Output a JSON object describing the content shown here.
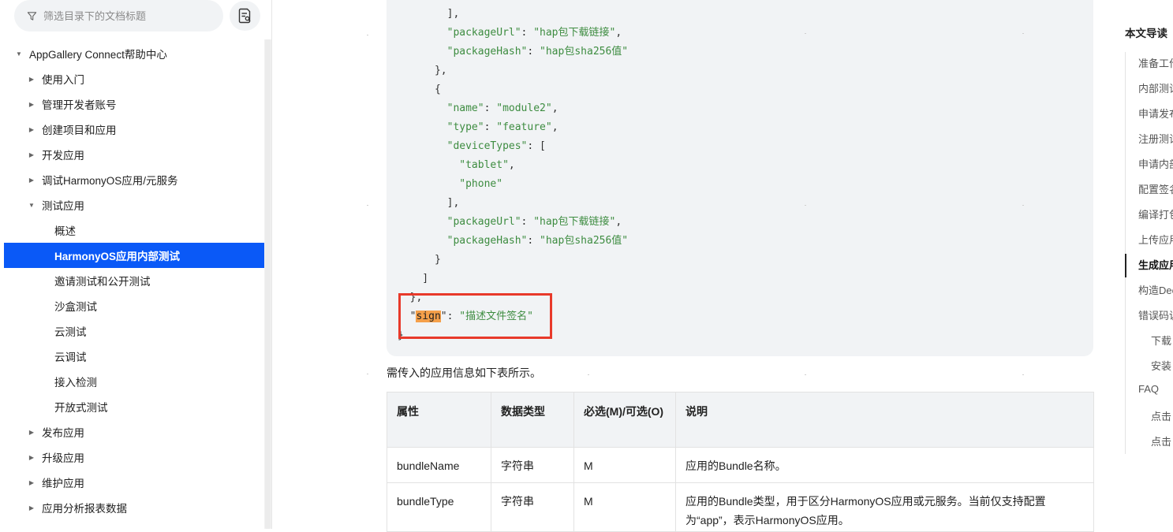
{
  "sidebar": {
    "filter_placeholder": "筛选目录下的文档标题",
    "items": [
      {
        "label": "AppGallery Connect帮助中心",
        "level": 0,
        "state": "expanded"
      },
      {
        "label": "使用入门",
        "level": 1,
        "state": "collapsed"
      },
      {
        "label": "管理开发者账号",
        "level": 1,
        "state": "collapsed"
      },
      {
        "label": "创建项目和应用",
        "level": 1,
        "state": "collapsed"
      },
      {
        "label": "开发应用",
        "level": 1,
        "state": "collapsed"
      },
      {
        "label": "调试HarmonyOS应用/元服务",
        "level": 1,
        "state": "collapsed"
      },
      {
        "label": "测试应用",
        "level": 1,
        "state": "expanded"
      },
      {
        "label": "概述",
        "level": 2,
        "state": "leaf"
      },
      {
        "label": "HarmonyOS应用内部测试",
        "level": 2,
        "state": "leaf",
        "active": true
      },
      {
        "label": "邀请测试和公开测试",
        "level": 2,
        "state": "leaf"
      },
      {
        "label": "沙盒测试",
        "level": 2,
        "state": "leaf"
      },
      {
        "label": "云测试",
        "level": 2,
        "state": "leaf"
      },
      {
        "label": "云调试",
        "level": 2,
        "state": "leaf"
      },
      {
        "label": "接入检测",
        "level": 2,
        "state": "leaf"
      },
      {
        "label": "开放式测试",
        "level": 2,
        "state": "leaf"
      },
      {
        "label": "发布应用",
        "level": 1,
        "state": "collapsed"
      },
      {
        "label": "升级应用",
        "level": 1,
        "state": "collapsed"
      },
      {
        "label": "维护应用",
        "level": 1,
        "state": "collapsed"
      },
      {
        "label": "应用分析报表数据",
        "level": 1,
        "state": "collapsed"
      }
    ]
  },
  "code": {
    "lines": [
      [
        {
          "t": "p",
          "v": "        ],"
        }
      ],
      [
        {
          "t": "p",
          "v": "        "
        },
        {
          "t": "k",
          "v": "\"packageUrl\""
        },
        {
          "t": "p",
          "v": ": "
        },
        {
          "t": "s",
          "v": "\"hap包下载链接\""
        },
        {
          "t": "p",
          "v": ","
        }
      ],
      [
        {
          "t": "p",
          "v": "        "
        },
        {
          "t": "k",
          "v": "\"packageHash\""
        },
        {
          "t": "p",
          "v": ": "
        },
        {
          "t": "s",
          "v": "\"hap包sha256值\""
        }
      ],
      [
        {
          "t": "p",
          "v": "      },"
        }
      ],
      [
        {
          "t": "p",
          "v": "      {"
        }
      ],
      [
        {
          "t": "p",
          "v": "        "
        },
        {
          "t": "k",
          "v": "\"name\""
        },
        {
          "t": "p",
          "v": ": "
        },
        {
          "t": "s",
          "v": "\"module2\""
        },
        {
          "t": "p",
          "v": ","
        }
      ],
      [
        {
          "t": "p",
          "v": "        "
        },
        {
          "t": "k",
          "v": "\"type\""
        },
        {
          "t": "p",
          "v": ": "
        },
        {
          "t": "s",
          "v": "\"feature\""
        },
        {
          "t": "p",
          "v": ","
        }
      ],
      [
        {
          "t": "p",
          "v": "        "
        },
        {
          "t": "k",
          "v": "\"deviceTypes\""
        },
        {
          "t": "p",
          "v": ": ["
        }
      ],
      [
        {
          "t": "p",
          "v": "          "
        },
        {
          "t": "s",
          "v": "\"tablet\""
        },
        {
          "t": "p",
          "v": ","
        }
      ],
      [
        {
          "t": "p",
          "v": "          "
        },
        {
          "t": "s",
          "v": "\"phone\""
        }
      ],
      [
        {
          "t": "p",
          "v": "        ],"
        }
      ],
      [
        {
          "t": "p",
          "v": "        "
        },
        {
          "t": "k",
          "v": "\"packageUrl\""
        },
        {
          "t": "p",
          "v": ": "
        },
        {
          "t": "s",
          "v": "\"hap包下载链接\""
        },
        {
          "t": "p",
          "v": ","
        }
      ],
      [
        {
          "t": "p",
          "v": "        "
        },
        {
          "t": "k",
          "v": "\"packageHash\""
        },
        {
          "t": "p",
          "v": ": "
        },
        {
          "t": "s",
          "v": "\"hap包sha256值\""
        }
      ],
      [
        {
          "t": "p",
          "v": "      }"
        }
      ],
      [
        {
          "t": "p",
          "v": "    ]"
        }
      ],
      [
        {
          "t": "p",
          "v": "  },"
        }
      ],
      [
        {
          "t": "p",
          "v": "  \""
        },
        {
          "t": "hl",
          "v": "sign"
        },
        {
          "t": "p",
          "v": "\": "
        },
        {
          "t": "s",
          "v": "\"描述文件签名\""
        }
      ],
      [
        {
          "t": "p",
          "v": "}"
        }
      ]
    ]
  },
  "intro_text": "需传入的应用信息如下表所示。",
  "table": {
    "headers": [
      "属性",
      "数据类型",
      "必选(M)/可选(O)",
      "说明"
    ],
    "rows": [
      [
        "bundleName",
        "字符串",
        "M",
        "应用的Bundle名称。"
      ],
      [
        "bundleType",
        "字符串",
        "M",
        "应用的Bundle类型，用于区分HarmonyOS应用或元服务。当前仅支持配置为“app”，表示HarmonyOS应用。"
      ]
    ]
  },
  "toc": {
    "title": "本文导读",
    "items": [
      {
        "label": "准备工作",
        "indent": 0
      },
      {
        "label": "内部测试",
        "indent": 0
      },
      {
        "label": "申请发布",
        "indent": 0
      },
      {
        "label": "注册测试",
        "indent": 0
      },
      {
        "label": "申请内部",
        "indent": 0
      },
      {
        "label": "配置签名",
        "indent": 0
      },
      {
        "label": "编译打包",
        "indent": 0
      },
      {
        "label": "上传应用",
        "indent": 0
      },
      {
        "label": "生成应用",
        "indent": 0,
        "active": true
      },
      {
        "label": "构造Deep",
        "indent": 0
      },
      {
        "label": "错误码说",
        "indent": 0
      },
      {
        "label": "下载",
        "indent": 1
      },
      {
        "label": "安装",
        "indent": 1
      },
      {
        "label": "FAQ",
        "indent": 0
      },
      {
        "label": "点击",
        "indent": 1
      },
      {
        "label": "点击",
        "indent": 1
      }
    ]
  },
  "colors": {
    "accent": "#0a59f7",
    "highlight_box": "#e8392a",
    "code_key": "#3d8c40",
    "search_highlight": "#f5a04a"
  }
}
